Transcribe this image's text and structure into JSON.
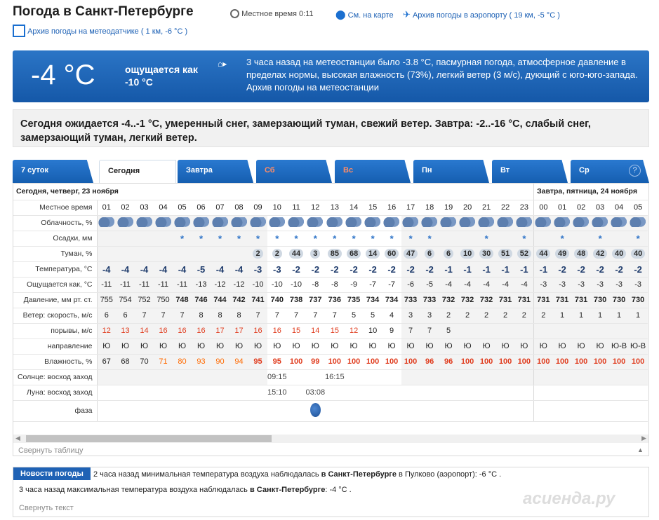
{
  "header": {
    "title": "Погода в Санкт-Петербурге",
    "local_time_label": "Местное время",
    "local_time": "0:11",
    "map_link": "См. на карте",
    "airport_link": "Архив погоды в аэропорту ( 19 км, -5 °С )",
    "station_link": "Архив погоды на метеодатчике ( 1 км, -6 °С )"
  },
  "current": {
    "temp": "-4 °C",
    "feels": "ощущается как -10 °C",
    "desc": "3 часа назад на метеостанции было -3.8 °C, пасмурная погода, атмосферное давление в пределах нормы, высокая влажность (73%), легкий ветер (3 м/с), дующий с юго-юго-запада. Архив погоды на метеостанции"
  },
  "forecast_text": "Сегодня ожидается -4..-1 °C, умеренный снег, замерзающий туман, свежий ветер. Завтра: -2..-16 °C, слабый снег, замерзающий туман, легкий ветер.",
  "tabs": [
    "7 суток",
    "Сегодня",
    "Завтра",
    "Сб",
    "Вс",
    "Пн",
    "Вт",
    "Ср"
  ],
  "help_icon": "?",
  "table": {
    "day1": "Сегодня, четверг, 23 ноября",
    "day2": "Завтра, пятница, 24 ноября",
    "labels": {
      "time": "Местное время",
      "clouds": "Облачность, %",
      "precip": "Осадки, мм",
      "fog": "Туман, %",
      "temp": "Температура, °C",
      "feels": "Ощущается как, °C",
      "pressure": "Давление, мм рт. ст.",
      "wind": "Ветер: скорость, м/с",
      "gusts": "порывы, м/с",
      "dir": "направление",
      "humidity": "Влажность, %",
      "sun": "Солнце: восход заход",
      "moon": "Луна: восход заход",
      "phase": "фаза"
    },
    "hours": [
      "01",
      "02",
      "03",
      "04",
      "05",
      "06",
      "07",
      "08",
      "09",
      "10",
      "11",
      "12",
      "13",
      "14",
      "15",
      "16",
      "17",
      "18",
      "19",
      "20",
      "21",
      "22",
      "23",
      "00",
      "01",
      "02",
      "03",
      "04",
      "05"
    ],
    "snow": [
      "",
      "",
      "",
      "",
      "*",
      "*",
      "*",
      "*",
      "*",
      "*",
      "*",
      "*",
      "*",
      "*",
      "*",
      "*",
      "*",
      "*",
      "",
      "",
      "*",
      "",
      "*",
      "",
      "*",
      "",
      "*",
      "",
      "*"
    ],
    "fog": [
      "",
      "",
      "",
      "",
      "",
      "",
      "",
      "",
      "2",
      "2",
      "44",
      "3",
      "85",
      "68",
      "14",
      "60",
      "47",
      "6",
      "6",
      "10",
      "30",
      "51",
      "52",
      "44",
      "49",
      "48",
      "42",
      "40",
      "40"
    ],
    "temp": [
      "-4",
      "-4",
      "-4",
      "-4",
      "-4",
      "-5",
      "-4",
      "-4",
      "-3",
      "-3",
      "-2",
      "-2",
      "-2",
      "-2",
      "-2",
      "-2",
      "-2",
      "-2",
      "-1",
      "-1",
      "-1",
      "-1",
      "-1",
      "-1",
      "-2",
      "-2",
      "-2",
      "-2",
      "-2"
    ],
    "feels": [
      "-11",
      "-11",
      "-11",
      "-11",
      "-11",
      "-13",
      "-12",
      "-12",
      "-10",
      "-10",
      "-10",
      "-8",
      "-8",
      "-9",
      "-7",
      "-7",
      "-6",
      "-5",
      "-4",
      "-4",
      "-4",
      "-4",
      "-4",
      "-3",
      "-3",
      "-3",
      "-3",
      "-3",
      "-3"
    ],
    "pressure": [
      "755",
      "754",
      "752",
      "750",
      "748",
      "746",
      "744",
      "742",
      "741",
      "740",
      "738",
      "737",
      "736",
      "735",
      "734",
      "734",
      "733",
      "733",
      "732",
      "732",
      "732",
      "731",
      "731",
      "731",
      "731",
      "731",
      "730",
      "730",
      "730"
    ],
    "wind": [
      "6",
      "6",
      "7",
      "7",
      "7",
      "8",
      "8",
      "8",
      "7",
      "7",
      "7",
      "7",
      "7",
      "5",
      "5",
      "4",
      "3",
      "3",
      "2",
      "2",
      "2",
      "2",
      "2",
      "2",
      "1",
      "1",
      "1",
      "1",
      "1"
    ],
    "gusts": [
      "12",
      "13",
      "14",
      "16",
      "16",
      "16",
      "17",
      "17",
      "16",
      "16",
      "15",
      "14",
      "15",
      "12",
      "10",
      "9",
      "7",
      "7",
      "5",
      "",
      "",
      "",
      "",
      "",
      "",
      "",
      "",
      "",
      ""
    ],
    "dir": [
      "Ю",
      "Ю",
      "Ю",
      "Ю",
      "Ю",
      "Ю",
      "Ю",
      "Ю",
      "Ю",
      "Ю",
      "Ю",
      "Ю",
      "Ю",
      "Ю",
      "Ю",
      "Ю",
      "Ю",
      "Ю",
      "Ю",
      "Ю",
      "Ю",
      "Ю",
      "Ю",
      "Ю",
      "Ю",
      "Ю",
      "Ю",
      "Ю-В",
      "Ю-В"
    ],
    "humidity": [
      "67",
      "68",
      "70",
      "71",
      "80",
      "93",
      "90",
      "94",
      "95",
      "95",
      "100",
      "99",
      "100",
      "100",
      "100",
      "100",
      "100",
      "96",
      "96",
      "100",
      "100",
      "100",
      "100",
      "100",
      "100",
      "100",
      "100",
      "100",
      "100"
    ],
    "sunrise": "09:15",
    "sunset": "16:15",
    "moonrise": "15:10",
    "moonset": "03:08"
  },
  "collapse_table": "Свернуть таблицу",
  "news": {
    "badge": "Новости погоды",
    "line1_a": "2 часа назад минимальная температура воздуха наблюдалась ",
    "line1_b": "в Санкт-Петербурге",
    "line1_c": " в Пулково (аэропорт): -6 °C .",
    "line2_a": "3 часа назад максимальная температура воздуха наблюдалась ",
    "line2_b": "в Санкт-Петербурге",
    "line2_c": ": -4 °C .",
    "collapse": "Свернуть текст"
  },
  "watermark": "асиенда.ру"
}
